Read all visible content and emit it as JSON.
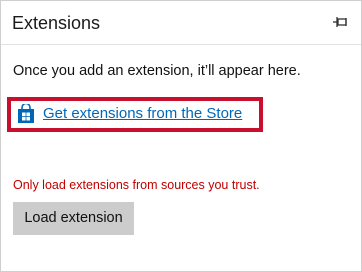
{
  "header": {
    "title": "Extensions",
    "pin_icon": "pin-icon"
  },
  "main": {
    "empty_message": "Once you add an extension, it’ll appear here.",
    "store_link": {
      "icon": "store-bag-icon",
      "label": "Get extensions from the Store",
      "highlight_color": "#c8102e"
    },
    "warning_text": "Only load extensions from sources you trust.",
    "load_button_label": "Load extension"
  },
  "colors": {
    "link": "#0067b8",
    "warning": "#c00000",
    "button_bg": "#cccccc"
  }
}
